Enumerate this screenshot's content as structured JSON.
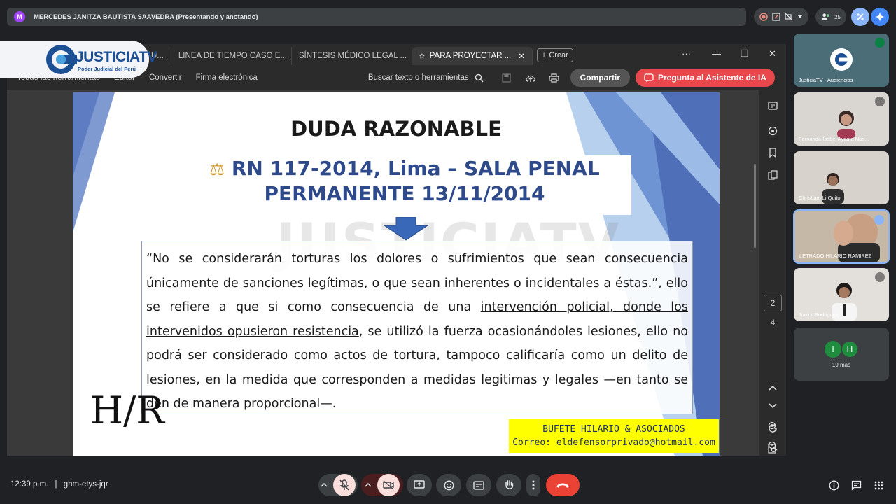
{
  "meet": {
    "presenter_initial": "M",
    "presenter_label": "MERCEDES JANITZA BAUTISTA SAAVEDRA (Presentando y anotando)",
    "participant_count": "25",
    "meeting_time": "12:39 p.m.",
    "separator": "|",
    "meeting_code": "ghm-etys-jqr"
  },
  "logo": {
    "brand": "JUSTICIATV",
    "subtitle": "Poder Judicial del Perú"
  },
  "browser": {
    "tabs": [
      {
        "label": "U..."
      },
      {
        "label": "LINEA DE TIEMPO CASO E..."
      },
      {
        "label": "SÍNTESIS MÉDICO LEGAL ..."
      },
      {
        "label": "PARA PROYECTAR ..."
      }
    ],
    "new_tab_label": "Crear",
    "more_label": "···"
  },
  "pdf_toolbar": {
    "all_tools": "Todas las herramientas",
    "edit": "Editar",
    "convert": "Convertir",
    "esign": "Firma electrónica",
    "search_placeholder": "Buscar texto o herramientas",
    "share": "Compartir",
    "ai_assistant": "Pregunta al Asistente de IA"
  },
  "slide": {
    "title": "DUDA RAZONABLE",
    "case_line1": "RN 117-2014, Lima – SALA PENAL",
    "case_line2": "PERMANENTE 13/11/2014",
    "watermark": "JUSTICIATV",
    "quote_part1": "“No se considerarán torturas los dolores o sufrimientos que sean consecuencia únicamente de sanciones legítimas, o que sean inherentes o incidentales a éstas.”, ello se refiere a que si como consecuencia de una ",
    "quote_underlined": "intervención policial, donde los intervenidos opusieron resistencia",
    "quote_part2": ", se utilizó la fuerza ocasionándoles lesiones, ello no podrá ser considerado como actos de tortura, tampoco calificaría como un delito de lesiones, en la medida que corresponden a medidas legitimas y legales —en tanto se den de manera proporcional—.",
    "monogram": "H/R",
    "footer_firm": "BUFETE HILARIO & ASOCIADOS",
    "footer_email": "Correo: eldefensorprivado@hotmail.com"
  },
  "pager": {
    "current": "2",
    "total": "4"
  },
  "participants": [
    {
      "name": "JusticiaTV - Audiencias"
    },
    {
      "name": "Fernanda Isabel Ayasta Nas..."
    },
    {
      "name": "Christiam Li Quito"
    },
    {
      "name": "LETRADO HILARIO RAMIREZ"
    },
    {
      "name": "Junior Rodriguez"
    }
  ],
  "more_tile": {
    "initial1": "I",
    "initial2": "H",
    "label": "19 más"
  }
}
